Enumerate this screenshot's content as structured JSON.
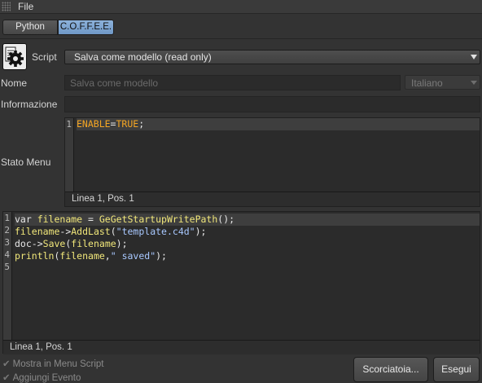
{
  "menubar": {
    "file_label": "File"
  },
  "tabs": [
    {
      "label": "Python",
      "active": false
    },
    {
      "label": "C.O.F.F.E.E.",
      "active": true
    }
  ],
  "script_row": {
    "label": "Script",
    "selected": "Salva come modello (read only)"
  },
  "name_row": {
    "label": "Nome",
    "placeholder": "Salva come modello",
    "language": "Italiano"
  },
  "info_row": {
    "label": "Informazione",
    "value": ""
  },
  "menu_state": {
    "label": "Stato Menu",
    "line_numbers": [
      "1"
    ],
    "code": [
      [
        {
          "t": "ENABLE",
          "c": "orange"
        },
        {
          "t": "=",
          "c": "white"
        },
        {
          "t": "TRUE",
          "c": "orange"
        },
        {
          "t": ";",
          "c": "white"
        }
      ]
    ],
    "status": "Linea 1, Pos. 1"
  },
  "script_editor": {
    "line_numbers": [
      "1",
      "2",
      "3",
      "4",
      "5"
    ],
    "code": [
      [
        {
          "t": "var ",
          "c": "white"
        },
        {
          "t": "filename",
          "c": "yellow"
        },
        {
          "t": " = ",
          "c": "white"
        },
        {
          "t": "GeGetStartupWritePath",
          "c": "yellow"
        },
        {
          "t": "();",
          "c": "white"
        }
      ],
      [
        {
          "t": "filename",
          "c": "yellow"
        },
        {
          "t": "->",
          "c": "white"
        },
        {
          "t": "AddLast",
          "c": "yellow"
        },
        {
          "t": "(",
          "c": "white"
        },
        {
          "t": "\"template.c4d\"",
          "c": "blue"
        },
        {
          "t": ");",
          "c": "white"
        }
      ],
      [
        {
          "t": "doc",
          "c": "white"
        },
        {
          "t": "->",
          "c": "white"
        },
        {
          "t": "Save",
          "c": "yellow"
        },
        {
          "t": "(",
          "c": "white"
        },
        {
          "t": "filename",
          "c": "yellow"
        },
        {
          "t": ");",
          "c": "white"
        }
      ],
      [
        {
          "t": "println",
          "c": "yellow"
        },
        {
          "t": "(",
          "c": "white"
        },
        {
          "t": "filename",
          "c": "yellow"
        },
        {
          "t": ",",
          "c": "white"
        },
        {
          "t": "\" saved\"",
          "c": "blue"
        },
        {
          "t": ");",
          "c": "white"
        }
      ],
      []
    ],
    "status": "Linea 1, Pos. 1"
  },
  "options": {
    "show_in_menu": {
      "label": "Mostra in Menu Script",
      "checked": true
    },
    "add_event": {
      "label": "Aggiungi Evento",
      "checked": true
    }
  },
  "buttons": {
    "shortcut": "Scorciatoia...",
    "run": "Esegui"
  },
  "colors": {
    "background": "#333333",
    "active_tab": "#7ba3d0",
    "keyword": "#f5a623",
    "identifier": "#f1e77a",
    "string": "#a8c8ff"
  }
}
